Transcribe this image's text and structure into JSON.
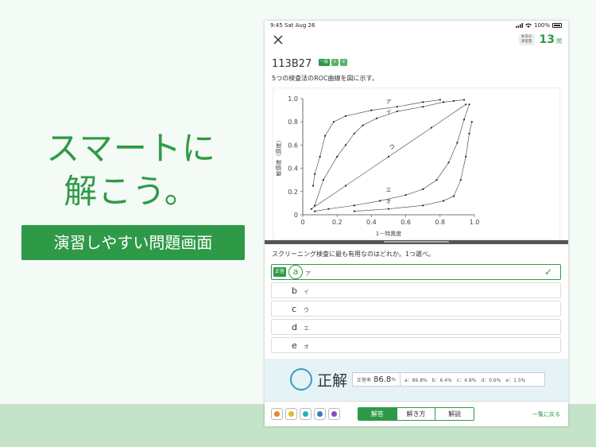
{
  "promo": {
    "title_line1": "スマートに",
    "title_line2": "解こう。",
    "badge": "演習しやすい問題画面"
  },
  "status_bar": {
    "time": "9:45  Sat Aug 26",
    "battery": "100%"
  },
  "header": {
    "counter_label_line1": "本日の",
    "counter_label_line2": "演習量",
    "counter_value": "13",
    "counter_unit": "問"
  },
  "question": {
    "id": "113B27",
    "tag_general": "一般",
    "tag_icon1": "①",
    "tag_icon2": "②",
    "stem": "5つの検査法のROC曲線を図に示す。",
    "prompt": "スクリーニング検査に最も有用なのはどれか。1つ選べ。"
  },
  "choices": [
    {
      "letter": "a",
      "text": "ア",
      "correct": true,
      "badge": "正答"
    },
    {
      "letter": "b",
      "text": "イ"
    },
    {
      "letter": "c",
      "text": "ウ"
    },
    {
      "letter": "d",
      "text": "エ"
    },
    {
      "letter": "e",
      "text": "オ"
    }
  ],
  "result": {
    "label": "正解",
    "rate_label": "正答率",
    "rate_value": "86.8",
    "rate_unit": "%",
    "dist": [
      "a：86.8%",
      "b：6.4%",
      "c：4.8%",
      "d：0.6%",
      "e：1.5%"
    ]
  },
  "toolbar": {
    "pens": [
      "#e08a2a",
      "#e8b820",
      "#2ab0b0",
      "#2a7ec0",
      "#8a4ac0"
    ],
    "tabs": [
      "解答",
      "解き方",
      "解説"
    ],
    "back": "一覧に戻る"
  },
  "chart_data": {
    "type": "line",
    "xlabel": "1－特異度",
    "ylabel": "敏感度（感度）",
    "xlim": [
      0,
      1.0
    ],
    "ylim": [
      0,
      1.0
    ],
    "xticks": [
      "0",
      "0.2",
      "0.4",
      "0.6",
      "0.8",
      "1.0"
    ],
    "yticks": [
      "0",
      "0.2",
      "0.4",
      "0.6",
      "0.8",
      "1.0"
    ],
    "series": [
      {
        "name": "ア",
        "x": [
          0.06,
          0.07,
          0.1,
          0.13,
          0.18,
          0.25,
          0.4,
          0.55,
          0.7,
          0.8
        ],
        "y": [
          0.25,
          0.35,
          0.5,
          0.68,
          0.8,
          0.85,
          0.9,
          0.93,
          0.97,
          0.99
        ]
      },
      {
        "name": "イ",
        "x": [
          0.07,
          0.12,
          0.2,
          0.25,
          0.3,
          0.35,
          0.43,
          0.55,
          0.7,
          0.82,
          0.88,
          0.94
        ],
        "y": [
          0.08,
          0.3,
          0.5,
          0.6,
          0.7,
          0.77,
          0.83,
          0.89,
          0.93,
          0.97,
          0.98,
          0.99
        ]
      },
      {
        "name": "ウ",
        "x": [
          0.05,
          0.25,
          0.5,
          0.75,
          0.95
        ],
        "y": [
          0.05,
          0.25,
          0.5,
          0.75,
          0.95
        ]
      },
      {
        "name": "エ",
        "x": [
          0.07,
          0.15,
          0.3,
          0.45,
          0.6,
          0.7,
          0.78,
          0.85,
          0.9,
          0.94,
          0.97
        ],
        "y": [
          0.03,
          0.05,
          0.08,
          0.12,
          0.17,
          0.22,
          0.3,
          0.45,
          0.62,
          0.82,
          0.95
        ]
      },
      {
        "name": "オ",
        "x": [
          0.3,
          0.5,
          0.7,
          0.82,
          0.88,
          0.92,
          0.95,
          0.97,
          0.985
        ],
        "y": [
          0.03,
          0.05,
          0.08,
          0.12,
          0.16,
          0.3,
          0.5,
          0.7,
          0.8
        ]
      }
    ]
  }
}
